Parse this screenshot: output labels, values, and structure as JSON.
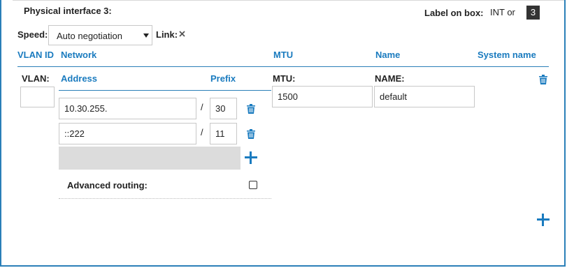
{
  "interface": {
    "title": "Physical interface 3:",
    "label_on_box": "Label on box:",
    "int_label": "INT or",
    "int_number": "3"
  },
  "speed": {
    "label": "Speed:",
    "value": "Auto negotiation",
    "link_label": "Link:",
    "link_status_icon": "close-icon"
  },
  "columns": {
    "vlan_id": "VLAN ID",
    "network": "Network",
    "mtu": "MTU",
    "name": "Name",
    "system_name": "System name"
  },
  "vlan": {
    "label": "VLAN:",
    "value": ""
  },
  "network": {
    "address_header": "Address",
    "prefix_header": "Prefix",
    "separator": "/",
    "rows": [
      {
        "address": "10.30.255.",
        "prefix": "30"
      },
      {
        "address": "::222",
        "prefix": "11"
      }
    ],
    "advanced_routing_label": "Advanced routing:"
  },
  "mtu": {
    "label": "MTU:",
    "value": "1500"
  },
  "name": {
    "label": "NAME:",
    "value": "default"
  },
  "colors": {
    "accent": "#1a7bbf",
    "border": "#2a7fb8"
  }
}
